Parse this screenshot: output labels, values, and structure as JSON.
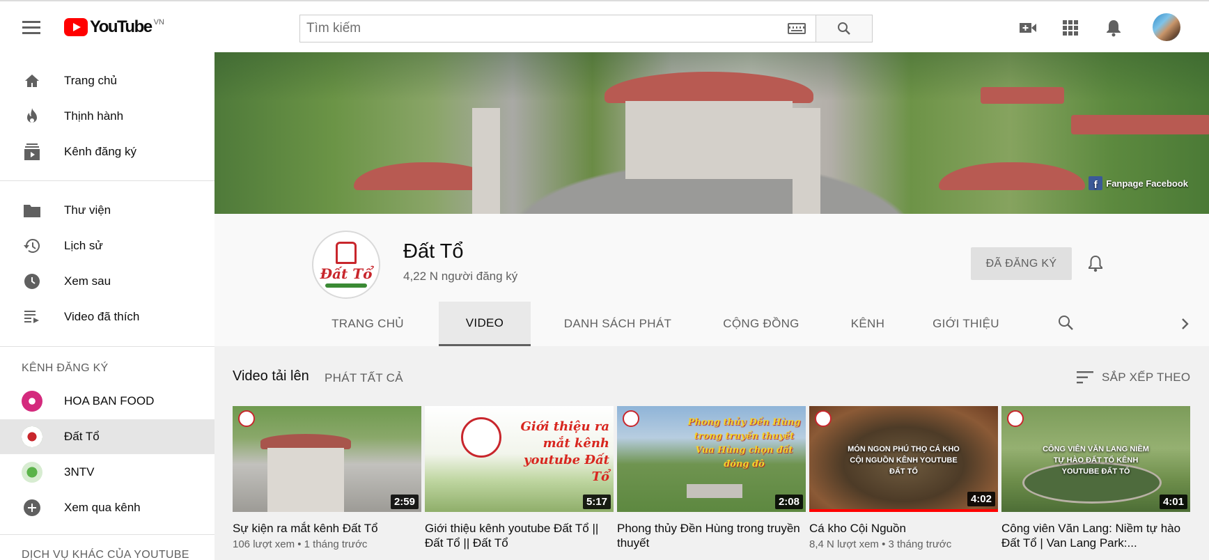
{
  "header": {
    "logo_text": "YouTube",
    "logo_country": "VN",
    "search_placeholder": "Tìm kiếm"
  },
  "sidebar": {
    "main_items": [
      {
        "label": "Trang chủ",
        "icon": "home-icon"
      },
      {
        "label": "Thịnh hành",
        "icon": "flame-icon"
      },
      {
        "label": "Kênh đăng ký",
        "icon": "subscriptions-icon"
      }
    ],
    "library_items": [
      {
        "label": "Thư viện",
        "icon": "folder-icon"
      },
      {
        "label": "Lịch sử",
        "icon": "history-icon"
      },
      {
        "label": "Xem sau",
        "icon": "clock-icon"
      },
      {
        "label": "Video đã thích",
        "icon": "playlist-icon"
      }
    ],
    "subscriptions_heading": "KÊNH ĐĂNG KÝ",
    "subscriptions": [
      {
        "label": "HOA BAN FOOD"
      },
      {
        "label": "Đất Tổ",
        "active": true
      },
      {
        "label": "3NTV"
      },
      {
        "label": "Xem qua kênh"
      }
    ],
    "more_heading": "DỊCH VỤ KHÁC CỦA YOUTUBE"
  },
  "banner": {
    "fanpage_label": "Fanpage Facebook"
  },
  "channel": {
    "logo_word": "Đất Tổ",
    "name": "Đất Tổ",
    "subscribers": "4,22 N người đăng ký",
    "subscribed_label": "ĐÃ ĐĂNG KÝ"
  },
  "tabs": [
    {
      "label": "TRANG CHỦ"
    },
    {
      "label": "VIDEO",
      "active": true
    },
    {
      "label": "DANH SÁCH PHÁT"
    },
    {
      "label": "CỘNG ĐỒNG"
    },
    {
      "label": "KÊNH"
    },
    {
      "label": "GIỚI THIỆU"
    }
  ],
  "uploads": {
    "title": "Video tải lên",
    "play_all": "PHÁT TẤT CẢ",
    "sort_label": "SẮP XẾP THEO"
  },
  "videos": [
    {
      "title": "Sự kiện ra mắt kênh Đất Tổ",
      "meta": "106 lượt xem • 1 tháng trước",
      "duration": "2:59",
      "overlay": ""
    },
    {
      "title": "Giới thiệu kênh youtube Đất Tổ || Đất Tổ || Đất Tổ",
      "meta": "",
      "duration": "5:17",
      "overlay": "Giới thiệu ra mắt kênh youtube Đất Tổ"
    },
    {
      "title": "Phong thủy Đền Hùng trong truyền thuyết",
      "meta": "",
      "duration": "2:08",
      "overlay": "Phong thủy Đền Hùng trong truyền thuyết Vua Hùng chọn đất đóng đô"
    },
    {
      "title": "Cá kho Cội Nguồn",
      "meta": "8,4 N lượt xem • 3 tháng trước",
      "duration": "4:02",
      "overlay": "MÓN NGON PHÚ THỌ CÁ KHO CỘI NGUỒN KÊNH YOUTUBE ĐẤT TỔ",
      "progress": 1.0
    },
    {
      "title": "Công viên Văn Lang: Niềm tự hào Đất Tổ | Van Lang Park:...",
      "meta": "",
      "duration": "4:01",
      "overlay": "CÔNG VIÊN VĂN LANG NIỀM TỰ HÀO ĐẤT TỔ KÊNH YOUTUBE ĐẤT TỔ"
    }
  ]
}
